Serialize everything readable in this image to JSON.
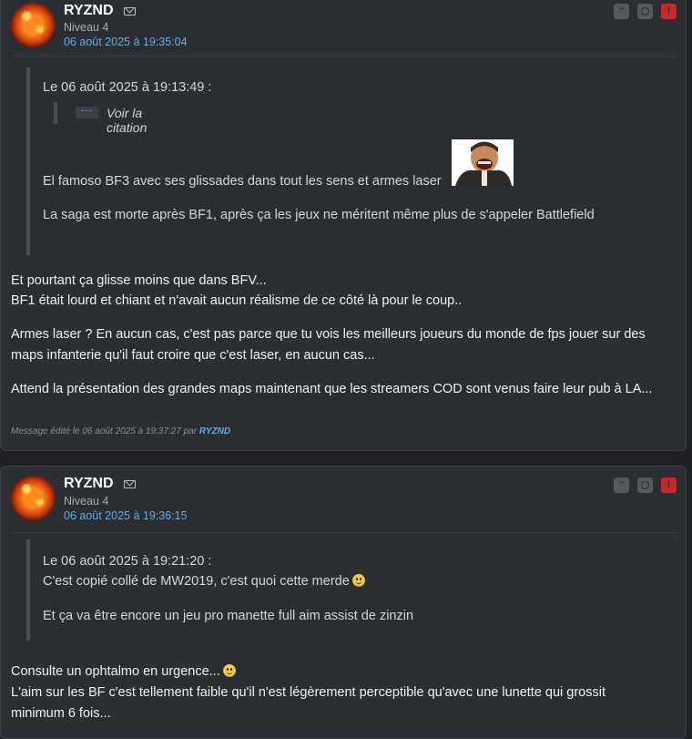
{
  "post1": {
    "author": "RYZND",
    "level": "Niveau 4",
    "date": "06 août 2025 à 19:35:04",
    "quote": {
      "header": "Le 06 août 2025 à 19:13:49 :",
      "nested_toggle": "···",
      "nested_label": "Voir la citation",
      "line1": "El famoso BF3 avec ses glissades dans tout les sens et armes laser",
      "line2": "La saga est morte après BF1, après ça les jeux ne méritent même plus de s'appeler Battlefield"
    },
    "body": [
      "Et pourtant ça glisse moins que dans BFV...",
      "BF1 était lourd et chiant et n'avait aucun réalisme de ce côté là pour le coup..",
      "Armes laser ? En aucun cas, c'est pas parce que tu vois les meilleurs joueurs du monde de fps jouer sur des",
      "maps infanterie qu'il faut croire que c'est laser, en aucun cas...",
      "Attend la présentation des grandes maps maintenant que les streamers COD sont venus faire leur pub à LA..."
    ],
    "edit_note": "Message édité le 06 août 2025 à 19:37:27 par",
    "edit_author": "RYZND"
  },
  "post2": {
    "author": "RYZND",
    "level": "Niveau 4",
    "date": "06 août 2025 à 19:36:15",
    "quote": {
      "header": "Le 06 août 2025 à 19:21:20 :",
      "line1": "C'est copié collé de MW2019, c'est quoi cette merde",
      "line2": "Et ça va être encore un jeu pro manette full aim assist de zinzin"
    },
    "body": [
      "Consulte un ophtalmo en urgence...",
      "L'aim sur les BF c'est tellement faible qu'il n'est légèrement perceptible qu'avec une lunette qui grossit",
      "minimum 6 fois..."
    ]
  },
  "actions": {
    "quote_icon": "quote-icon",
    "mp_icon": "private-message-icon",
    "alert_icon": "report-icon",
    "quote_glyph": "“",
    "alert_glyph": "!"
  },
  "colors": {
    "background": "#1e2023",
    "post_bg": "#2b2e33",
    "link": "#55aef0",
    "alert": "#c8282a"
  }
}
